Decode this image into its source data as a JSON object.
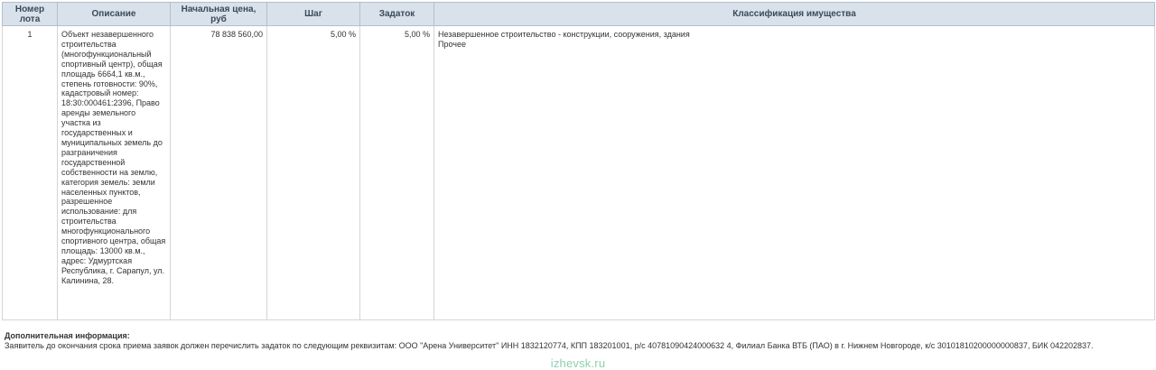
{
  "table": {
    "headers": {
      "lot_number": "Номер лота",
      "description": "Описание",
      "start_price": "Начальная цена, руб",
      "step": "Шаг",
      "deposit": "Задаток",
      "classification": "Классификация имущества"
    },
    "rows": [
      {
        "lot_number": "1",
        "description": "Объект незавершенного строительства (многофункциональный спортивный центр), общая площадь 6664,1 кв.м., степень готовности: 90%, кадастровый номер: 18:30:000461:2396, Право аренды земельного участка из государственных и муниципальных земель до разграничения государственной собственности на землю, категория земель: земли населенных пунктов, разрешенное использование: для строительства многофункционального спортивного центра, общая площадь: 13000 кв.м., адрес: Удмуртская Республика, г. Сарапул, ул. Калинина, 28.",
        "start_price": "78 838 560,00",
        "step": "5,00 %",
        "deposit": "5,00 %",
        "classification": [
          "Незавершенное строительство - конструкции, сооружения, здания",
          "Прочее"
        ]
      }
    ]
  },
  "additional_info": {
    "title": "Дополнительная информация:",
    "text": "Заявитель до окончания срока приема заявок должен перечислить задаток по следующим реквизитам: ООО \"Арена Университет\" ИНН 1832120774, КПП 183201001, р/с 40781090424000632 4, Филиал Банка ВТБ (ПАО) в г. Нижнем Новгороде, к/с 30101810200000000837, БИК 042202837."
  },
  "watermark": "izhevsk.ru"
}
